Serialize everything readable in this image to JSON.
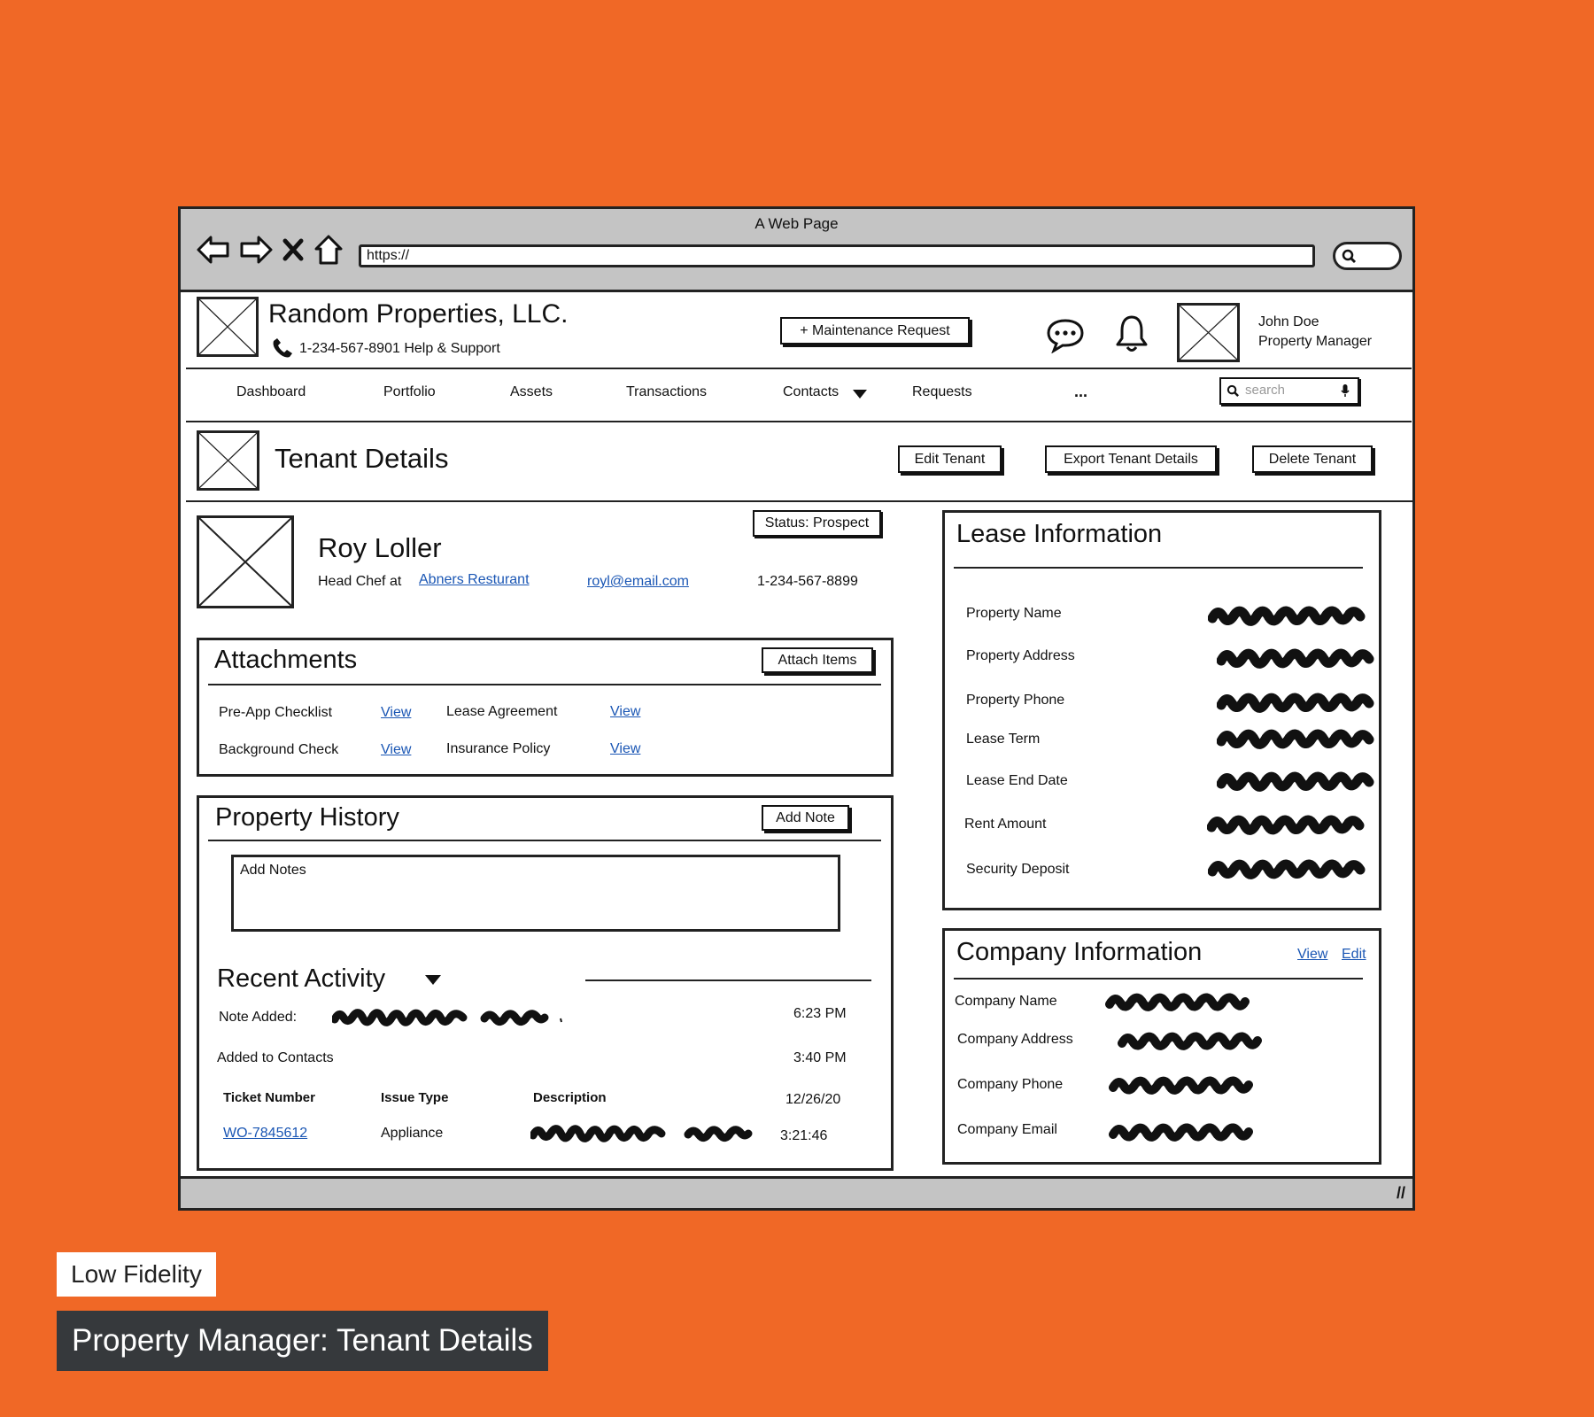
{
  "window": {
    "title": "A Web Page",
    "url": "https://"
  },
  "header": {
    "company_name": "Random Properties, LLC.",
    "support_line": "1-234-567-8901 Help & Support",
    "maintenance_button": "+ Maintenance Request",
    "user_name": "John Doe",
    "user_role": "Property Manager"
  },
  "nav": {
    "items": [
      "Dashboard",
      "Portfolio",
      "Assets",
      "Transactions",
      "Contacts",
      "Requests",
      "..."
    ],
    "search_placeholder": "search"
  },
  "page": {
    "title": "Tenant Details",
    "actions": [
      "Edit Tenant",
      "Export Tenant Details",
      "Delete Tenant"
    ]
  },
  "tenant": {
    "name": "Roy Loller",
    "role_prefix": "Head Chef at",
    "employer": "Abners Resturant",
    "email": "royl@email.com",
    "phone": "1-234-567-8899",
    "status": "Status: Prospect"
  },
  "attachments": {
    "title": "Attachments",
    "button": "Attach Items",
    "items": [
      {
        "name": "Pre-App Checklist",
        "link": "View"
      },
      {
        "name": "Lease Agreement",
        "link": "View"
      },
      {
        "name": "Background Check",
        "link": "View"
      },
      {
        "name": "Insurance Policy",
        "link": "View"
      }
    ]
  },
  "history": {
    "title": "Property History",
    "button": "Add Note",
    "notes_placeholder": "Add Notes",
    "recent_title": "Recent Activity",
    "activity": [
      {
        "label": "Note Added:",
        "time": "6:23 PM"
      },
      {
        "label": "Added to Contacts",
        "time": "3:40 PM"
      }
    ],
    "ticket_headers": [
      "Ticket Number",
      "Issue Type",
      "Description"
    ],
    "ticket_date": "12/26/20",
    "ticket": {
      "number": "WO-7845612",
      "type": "Appliance",
      "time": "3:21:46"
    }
  },
  "lease": {
    "title": "Lease Information",
    "fields": [
      "Property Name",
      "Property Address",
      "Property Phone",
      "Lease Term",
      "Lease End Date",
      "Rent Amount",
      "Security Deposit"
    ]
  },
  "company": {
    "title": "Company Information",
    "view_link": "View",
    "edit_link": "Edit",
    "fields": [
      "Company Name",
      "Company Address",
      "Company Phone",
      "Company Email"
    ]
  },
  "footer_labels": {
    "fidelity": "Low Fidelity",
    "caption": "Property Manager: Tenant Details"
  },
  "colors": {
    "background": "#F06826",
    "chrome": "#C4C4C4",
    "link": "#1A56B4",
    "caption_bg": "#36393C"
  }
}
